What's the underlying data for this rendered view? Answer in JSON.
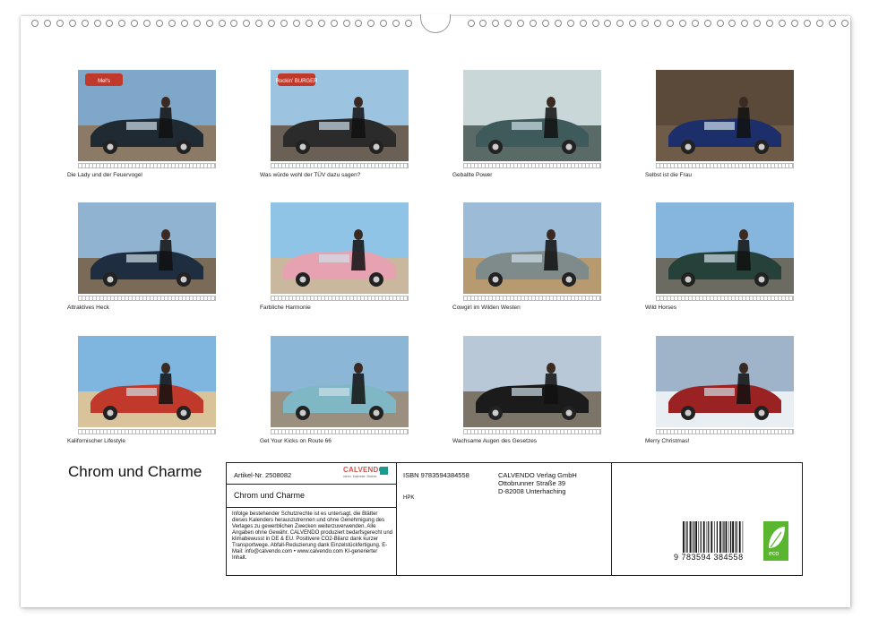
{
  "calendar": {
    "title": "Chrom und Charme",
    "months": [
      {
        "caption": "Die Lady und der Feuervogel",
        "sign": "Mel's",
        "sky": "#7fa7c9",
        "ground": "#8a7a66",
        "car": "#1f2a33"
      },
      {
        "caption": "Was würde wohl der TÜV dazu sagen?",
        "sign": "Rockin' BURGER",
        "sky": "#9cc3e0",
        "ground": "#6b6055",
        "car": "#2b2b2b"
      },
      {
        "caption": "Geballte Power",
        "sign": "",
        "sky": "#c9d7d9",
        "ground": "#5a6a66",
        "car": "#3f5a5a"
      },
      {
        "caption": "Selbst ist die Frau",
        "sign": "",
        "sky": "#5b4a3a",
        "ground": "#6e5b48",
        "car": "#1d2f6b"
      },
      {
        "caption": "Attraktives Heck",
        "sign": "",
        "sky": "#8fb3d0",
        "ground": "#7a6a58",
        "car": "#1e2d40"
      },
      {
        "caption": "Farbliche Harmonie",
        "sign": "",
        "sky": "#8fc4e6",
        "ground": "#c9b89e",
        "car": "#e7a2b2"
      },
      {
        "caption": "Cowgirl im Wilden Westen",
        "sign": "",
        "sky": "#9bbbd6",
        "ground": "#b89a70",
        "car": "#7f8a8a"
      },
      {
        "caption": "Wild Horses",
        "sign": "",
        "sky": "#86b5dd",
        "ground": "#6b6b62",
        "car": "#26403a"
      },
      {
        "caption": "Kalifornischer Lifestyle",
        "sign": "",
        "sky": "#7fb6e0",
        "ground": "#d9c39b",
        "car": "#c0392b"
      },
      {
        "caption": "Get Your Kicks on Route 66",
        "sign": "",
        "sky": "#8cb6d6",
        "ground": "#9b8f80",
        "car": "#7fb8c4"
      },
      {
        "caption": "Wachsame Augen des Gesetzes",
        "sign": "",
        "sky": "#b8c8d6",
        "ground": "#7d7468",
        "car": "#1b1b1b"
      },
      {
        "caption": "Merry Christmas!",
        "sign": "",
        "sky": "#9fb4c8",
        "ground": "#e9eef2",
        "car": "#9b2222"
      }
    ]
  },
  "imprint": {
    "article": "Artikel-Nr. 2508082",
    "brand": "CALVENDO",
    "brand_sub": "Ideen. Kalender. Bücher.",
    "product_title": "Chrom und Charme",
    "legal_text": "Infolge bestehender Schutzrechte ist es untersagt, die Blätter dieses Kalenders herauszutrennen und ohne Genehmigung des Verlages zu gewerblichen Zwecken weiterzuverwenden. Alle Angaben ohne Gewähr. CALVENDO produziert bedarfsgerecht und klimabewusst in DE & EU. Positivere CO2-Bilanz dank kurzer Transportwege. Abfall-Reduzierung dank Einzelstückfertigung. E-Mail: info@calvendo.com • www.calvendo.com KI-generierter Inhalt.",
    "isbn": "ISBN 9783594384558",
    "hpk": "HPK",
    "publisher_line1": "CALVENDO Verlag GmbH",
    "publisher_line2": "Ottobrunner Straße 39",
    "publisher_line3": "D-82008 Unterhaching",
    "ean_digits": "9 783594 384558",
    "eco_label": "eco"
  }
}
